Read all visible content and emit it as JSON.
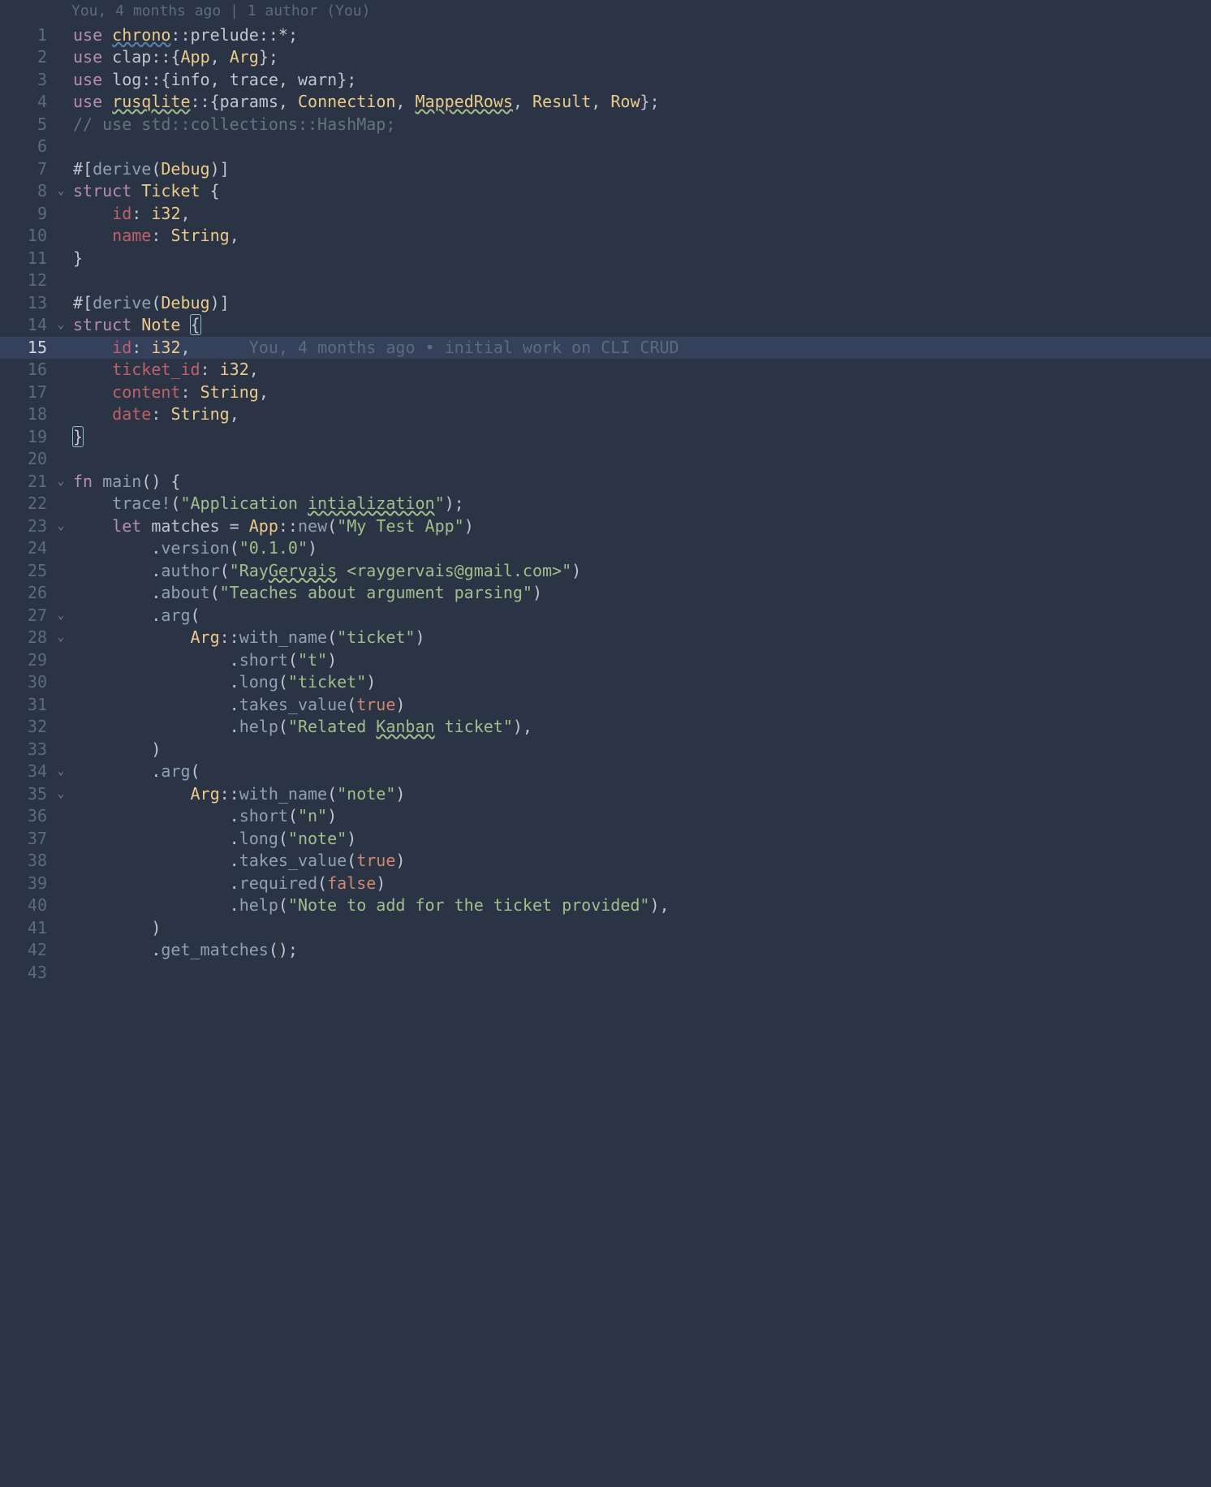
{
  "blame_header": "You, 4 months ago | 1 author (You)",
  "blame_inline": "You, 4 months ago • initial work on CLI CRUD",
  "current_line": 15,
  "fold_lines": [
    8,
    14,
    21,
    23,
    27,
    28,
    34,
    35
  ],
  "lines": [
    {
      "n": 1,
      "tokens": [
        [
          "kw",
          "use"
        ],
        [
          "id",
          " "
        ],
        [
          "ty sq-warn",
          "chrono"
        ],
        [
          "op",
          "::"
        ],
        [
          "id",
          "prelude"
        ],
        [
          "op",
          "::"
        ],
        [
          "op",
          "*"
        ],
        [
          "op",
          ";"
        ]
      ]
    },
    {
      "n": 2,
      "tokens": [
        [
          "kw",
          "use"
        ],
        [
          "id",
          " "
        ],
        [
          "id",
          "clap"
        ],
        [
          "op",
          "::"
        ],
        [
          "op",
          "{"
        ],
        [
          "ty",
          "App"
        ],
        [
          "op",
          ", "
        ],
        [
          "ty",
          "Arg"
        ],
        [
          "op",
          "}"
        ],
        [
          "op",
          ";"
        ]
      ]
    },
    {
      "n": 3,
      "tokens": [
        [
          "kw",
          "use"
        ],
        [
          "id",
          " "
        ],
        [
          "id",
          "log"
        ],
        [
          "op",
          "::"
        ],
        [
          "op",
          "{"
        ],
        [
          "id",
          "info"
        ],
        [
          "op",
          ", "
        ],
        [
          "id",
          "trace"
        ],
        [
          "op",
          ", "
        ],
        [
          "id",
          "warn"
        ],
        [
          "op",
          "}"
        ],
        [
          "op",
          ";"
        ]
      ]
    },
    {
      "n": 4,
      "tokens": [
        [
          "kw",
          "use"
        ],
        [
          "id",
          " "
        ],
        [
          "ty sq-spell",
          "rusqlite"
        ],
        [
          "op",
          "::"
        ],
        [
          "op",
          "{"
        ],
        [
          "id",
          "params"
        ],
        [
          "op",
          ", "
        ],
        [
          "ty",
          "Connection"
        ],
        [
          "op",
          ", "
        ],
        [
          "ty sq-spell",
          "MappedRows"
        ],
        [
          "op",
          ", "
        ],
        [
          "ty",
          "Result"
        ],
        [
          "op",
          ", "
        ],
        [
          "ty",
          "Row"
        ],
        [
          "op",
          "}"
        ],
        [
          "op",
          ";"
        ]
      ]
    },
    {
      "n": 5,
      "tokens": [
        [
          "cm",
          "// use std::collections::HashMap;"
        ]
      ]
    },
    {
      "n": 6,
      "tokens": []
    },
    {
      "n": 7,
      "tokens": [
        [
          "attr",
          "#["
        ],
        [
          "fn",
          "derive"
        ],
        [
          "attr",
          "("
        ],
        [
          "ty",
          "Debug"
        ],
        [
          "attr",
          ")]"
        ]
      ]
    },
    {
      "n": 8,
      "tokens": [
        [
          "kw",
          "struct"
        ],
        [
          "id",
          " "
        ],
        [
          "ty",
          "Ticket"
        ],
        [
          "id",
          " "
        ],
        [
          "op",
          "{"
        ]
      ]
    },
    {
      "n": 9,
      "tokens": [
        [
          "id",
          "    "
        ],
        [
          "fld",
          "id"
        ],
        [
          "op",
          ": "
        ],
        [
          "ty",
          "i32"
        ],
        [
          "op",
          ","
        ]
      ]
    },
    {
      "n": 10,
      "tokens": [
        [
          "id",
          "    "
        ],
        [
          "fld",
          "name"
        ],
        [
          "op",
          ": "
        ],
        [
          "ty",
          "String"
        ],
        [
          "op",
          ","
        ]
      ]
    },
    {
      "n": 11,
      "tokens": [
        [
          "op",
          "}"
        ]
      ]
    },
    {
      "n": 12,
      "tokens": []
    },
    {
      "n": 13,
      "tokens": [
        [
          "attr",
          "#["
        ],
        [
          "fn",
          "derive"
        ],
        [
          "attr",
          "("
        ],
        [
          "ty",
          "Debug"
        ],
        [
          "attr",
          ")]"
        ]
      ]
    },
    {
      "n": 14,
      "tokens": [
        [
          "kw",
          "struct"
        ],
        [
          "id",
          " "
        ],
        [
          "ty",
          "Note"
        ],
        [
          "id",
          " "
        ],
        [
          "op brace-hl",
          "{"
        ]
      ]
    },
    {
      "n": 15,
      "tokens": [
        [
          "id",
          "    "
        ],
        [
          "fld",
          "id"
        ],
        [
          "op",
          ": "
        ],
        [
          "ty",
          "i32"
        ],
        [
          "op",
          ","
        ]
      ],
      "blame": true
    },
    {
      "n": 16,
      "tokens": [
        [
          "id",
          "    "
        ],
        [
          "fld",
          "ticket_id"
        ],
        [
          "op",
          ": "
        ],
        [
          "ty",
          "i32"
        ],
        [
          "op",
          ","
        ]
      ]
    },
    {
      "n": 17,
      "tokens": [
        [
          "id",
          "    "
        ],
        [
          "fld",
          "content"
        ],
        [
          "op",
          ": "
        ],
        [
          "ty",
          "String"
        ],
        [
          "op",
          ","
        ]
      ]
    },
    {
      "n": 18,
      "tokens": [
        [
          "id",
          "    "
        ],
        [
          "fld",
          "date"
        ],
        [
          "op",
          ": "
        ],
        [
          "ty",
          "String"
        ],
        [
          "op",
          ","
        ]
      ]
    },
    {
      "n": 19,
      "tokens": [
        [
          "op brace-hl",
          "}"
        ]
      ]
    },
    {
      "n": 20,
      "tokens": []
    },
    {
      "n": 21,
      "tokens": [
        [
          "kw",
          "fn"
        ],
        [
          "id",
          " "
        ],
        [
          "fn",
          "main"
        ],
        [
          "op",
          "() {"
        ]
      ]
    },
    {
      "n": 22,
      "tokens": [
        [
          "id",
          "    "
        ],
        [
          "fn",
          "trace!"
        ],
        [
          "op",
          "("
        ],
        [
          "st",
          "\"Application "
        ],
        [
          "st sq-spell",
          "intialization"
        ],
        [
          "st",
          "\""
        ],
        [
          "op",
          ");"
        ]
      ]
    },
    {
      "n": 23,
      "tokens": [
        [
          "id",
          "    "
        ],
        [
          "kw",
          "let"
        ],
        [
          "id",
          " matches "
        ],
        [
          "op",
          "="
        ],
        [
          "id",
          " "
        ],
        [
          "ty",
          "App"
        ],
        [
          "op",
          "::"
        ],
        [
          "fn",
          "new"
        ],
        [
          "op",
          "("
        ],
        [
          "st",
          "\"My Test App\""
        ],
        [
          "op",
          ")"
        ]
      ]
    },
    {
      "n": 24,
      "tokens": [
        [
          "id",
          "        ."
        ],
        [
          "fn",
          "version"
        ],
        [
          "op",
          "("
        ],
        [
          "st",
          "\"0.1.0\""
        ],
        [
          "op",
          ")"
        ]
      ]
    },
    {
      "n": 25,
      "tokens": [
        [
          "id",
          "        ."
        ],
        [
          "fn",
          "author"
        ],
        [
          "op",
          "("
        ],
        [
          "st",
          "\"Ray"
        ],
        [
          "st sq-spell",
          "Gervais"
        ],
        [
          "st",
          " <raygervais@gmail.com>\""
        ],
        [
          "op",
          ")"
        ]
      ]
    },
    {
      "n": 26,
      "tokens": [
        [
          "id",
          "        ."
        ],
        [
          "fn",
          "about"
        ],
        [
          "op",
          "("
        ],
        [
          "st",
          "\"Teaches about argument parsing\""
        ],
        [
          "op",
          ")"
        ]
      ]
    },
    {
      "n": 27,
      "tokens": [
        [
          "id",
          "        ."
        ],
        [
          "fn",
          "arg"
        ],
        [
          "op",
          "("
        ]
      ]
    },
    {
      "n": 28,
      "tokens": [
        [
          "id",
          "            "
        ],
        [
          "ty",
          "Arg"
        ],
        [
          "op",
          "::"
        ],
        [
          "fn",
          "with_name"
        ],
        [
          "op",
          "("
        ],
        [
          "st",
          "\"ticket\""
        ],
        [
          "op",
          ")"
        ]
      ]
    },
    {
      "n": 29,
      "tokens": [
        [
          "id",
          "                ."
        ],
        [
          "fn",
          "short"
        ],
        [
          "op",
          "("
        ],
        [
          "st",
          "\"t\""
        ],
        [
          "op",
          ")"
        ]
      ]
    },
    {
      "n": 30,
      "tokens": [
        [
          "id",
          "                ."
        ],
        [
          "fn",
          "long"
        ],
        [
          "op",
          "("
        ],
        [
          "st",
          "\"ticket\""
        ],
        [
          "op",
          ")"
        ]
      ]
    },
    {
      "n": 31,
      "tokens": [
        [
          "id",
          "                ."
        ],
        [
          "fn",
          "takes_value"
        ],
        [
          "op",
          "("
        ],
        [
          "bool",
          "true"
        ],
        [
          "op",
          ")"
        ]
      ]
    },
    {
      "n": 32,
      "tokens": [
        [
          "id",
          "                ."
        ],
        [
          "fn",
          "help"
        ],
        [
          "op",
          "("
        ],
        [
          "st",
          "\"Related "
        ],
        [
          "st sq-spell",
          "Kanban"
        ],
        [
          "st",
          " ticket\""
        ],
        [
          "op",
          "),"
        ]
      ]
    },
    {
      "n": 33,
      "tokens": [
        [
          "id",
          "        "
        ],
        [
          "op",
          ")"
        ]
      ]
    },
    {
      "n": 34,
      "tokens": [
        [
          "id",
          "        ."
        ],
        [
          "fn",
          "arg"
        ],
        [
          "op",
          "("
        ]
      ]
    },
    {
      "n": 35,
      "tokens": [
        [
          "id",
          "            "
        ],
        [
          "ty",
          "Arg"
        ],
        [
          "op",
          "::"
        ],
        [
          "fn",
          "with_name"
        ],
        [
          "op",
          "("
        ],
        [
          "st",
          "\"note\""
        ],
        [
          "op",
          ")"
        ]
      ]
    },
    {
      "n": 36,
      "tokens": [
        [
          "id",
          "                ."
        ],
        [
          "fn",
          "short"
        ],
        [
          "op",
          "("
        ],
        [
          "st",
          "\"n\""
        ],
        [
          "op",
          ")"
        ]
      ]
    },
    {
      "n": 37,
      "tokens": [
        [
          "id",
          "                ."
        ],
        [
          "fn",
          "long"
        ],
        [
          "op",
          "("
        ],
        [
          "st",
          "\"note\""
        ],
        [
          "op",
          ")"
        ]
      ]
    },
    {
      "n": 38,
      "tokens": [
        [
          "id",
          "                ."
        ],
        [
          "fn",
          "takes_value"
        ],
        [
          "op",
          "("
        ],
        [
          "bool",
          "true"
        ],
        [
          "op",
          ")"
        ]
      ]
    },
    {
      "n": 39,
      "tokens": [
        [
          "id",
          "                ."
        ],
        [
          "fn",
          "required"
        ],
        [
          "op",
          "("
        ],
        [
          "bool",
          "false"
        ],
        [
          "op",
          ")"
        ]
      ]
    },
    {
      "n": 40,
      "tokens": [
        [
          "id",
          "                ."
        ],
        [
          "fn",
          "help"
        ],
        [
          "op",
          "("
        ],
        [
          "st",
          "\"Note to add for the ticket provided\""
        ],
        [
          "op",
          "),"
        ]
      ]
    },
    {
      "n": 41,
      "tokens": [
        [
          "id",
          "        "
        ],
        [
          "op",
          ")"
        ]
      ]
    },
    {
      "n": 42,
      "tokens": [
        [
          "id",
          "        ."
        ],
        [
          "fn",
          "get_matches"
        ],
        [
          "op",
          "();"
        ]
      ]
    },
    {
      "n": 43,
      "tokens": []
    }
  ]
}
